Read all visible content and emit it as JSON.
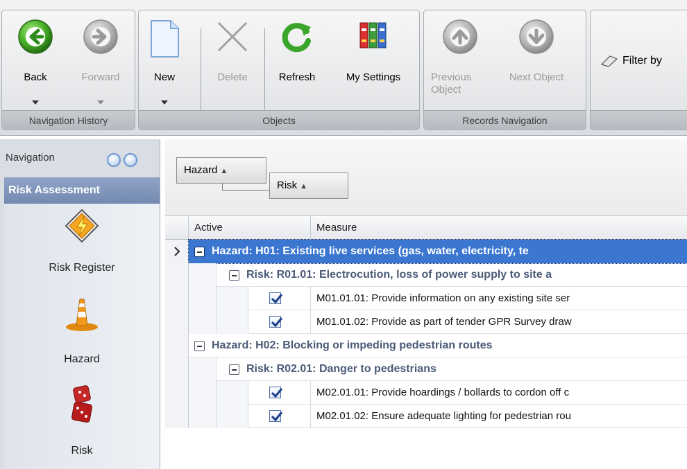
{
  "ribbon": {
    "groups": {
      "nav_history": "Navigation History",
      "objects": "Objects",
      "records_nav": "Records Navigation"
    },
    "buttons": {
      "back": "Back",
      "forward": "Forward",
      "new": "New",
      "delete": "Delete",
      "refresh": "Refresh",
      "my_settings": "My Settings",
      "previous_object": "Previous\nObject",
      "next_object": "Next Object",
      "filter_by": "Filter by"
    }
  },
  "navigation": {
    "title": "Navigation",
    "group": "Risk Assessment",
    "items": [
      {
        "label": "Risk Register",
        "icon": "lightning-diamond-icon"
      },
      {
        "label": "Hazard",
        "icon": "traffic-cone-icon"
      },
      {
        "label": "Risk",
        "icon": "dice-icon"
      }
    ]
  },
  "grid": {
    "group_chips": [
      "Hazard",
      "Risk"
    ],
    "sort_indicator": "▲",
    "columns": [
      "Active",
      "Measure"
    ],
    "rows": [
      {
        "type": "hazard",
        "text": "Hazard: H01: Existing live services (gas, water, electricity, te",
        "selected": true
      },
      {
        "type": "risk",
        "text": "Risk: R01.01: Electrocution, loss of power supply to site a"
      },
      {
        "type": "measure",
        "active": true,
        "text": "M01.01.01: Provide information on any existing site ser"
      },
      {
        "type": "measure",
        "active": true,
        "text": "M01.01.02: Provide as part of tender GPR Survey draw"
      },
      {
        "type": "hazard",
        "text": "Hazard: H02: Blocking or impeding pedestrian routes"
      },
      {
        "type": "risk",
        "text": "Risk: R02.01: Danger to pedestrians"
      },
      {
        "type": "measure",
        "active": true,
        "text": "M02.01.01: Provide hoardings / bollards to cordon off c"
      },
      {
        "type": "measure",
        "active": true,
        "text": "M02.01.02: Ensure adequate lighting for pedestrian rou"
      }
    ]
  },
  "colors": {
    "selection": "#3b76d1",
    "group_text": "#4b5a77",
    "nav_group_header": "#7f95bc"
  }
}
